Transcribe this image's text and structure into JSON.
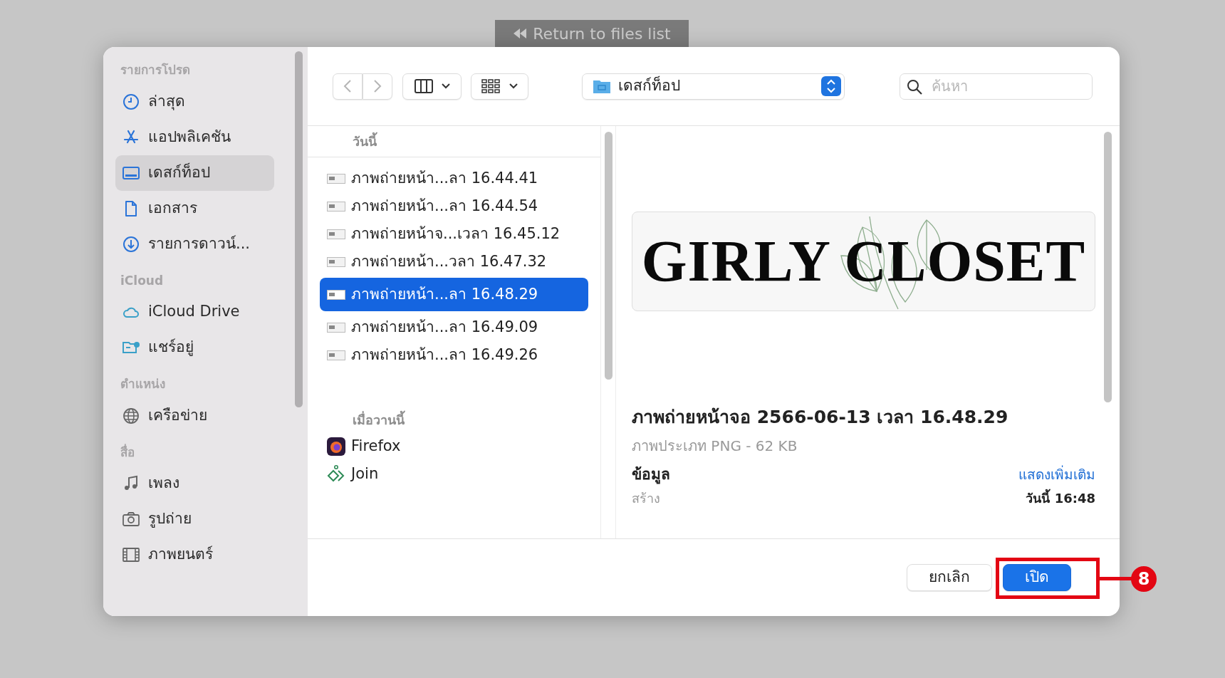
{
  "background_button": {
    "label": "Return to files list"
  },
  "sidebar": {
    "sections": [
      {
        "title": "รายการโปรด",
        "items": [
          {
            "label": "ล่าสุด",
            "selected": false
          },
          {
            "label": "แอปพลิเคชัน",
            "selected": false
          },
          {
            "label": "เดสก์ท็อป",
            "selected": true
          },
          {
            "label": "เอกสาร",
            "selected": false
          },
          {
            "label": "รายการดาวน์...",
            "selected": false
          }
        ]
      },
      {
        "title": "iCloud",
        "items": [
          {
            "label": "iCloud Drive",
            "selected": false
          },
          {
            "label": "แชร์อยู่",
            "selected": false
          }
        ]
      },
      {
        "title": "ตำแหน่ง",
        "items": [
          {
            "label": "เครือข่าย",
            "selected": false
          }
        ]
      },
      {
        "title": "สื่อ",
        "items": [
          {
            "label": "เพลง",
            "selected": false
          },
          {
            "label": "รูปถ่าย",
            "selected": false
          },
          {
            "label": "ภาพยนตร์",
            "selected": false
          }
        ]
      }
    ]
  },
  "toolbar": {
    "location": "เดสก์ท็อป",
    "search": {
      "placeholder": "ค้นหา"
    }
  },
  "file_list": {
    "groups": [
      {
        "title": "วันนี้",
        "items": [
          {
            "name": "ภาพถ่ายหน้า...ลา 16.44.41",
            "kind": "screenshot",
            "selected": false
          },
          {
            "name": "ภาพถ่ายหน้า...ลา 16.44.54",
            "kind": "screenshot",
            "selected": false
          },
          {
            "name": "ภาพถ่ายหน้าจ...เวลา 16.45.12",
            "kind": "screenshot",
            "selected": false
          },
          {
            "name": "ภาพถ่ายหน้า...วลา 16.47.32",
            "kind": "screenshot",
            "selected": false
          },
          {
            "name": "ภาพถ่ายหน้า...ลา 16.48.29",
            "kind": "screenshot",
            "selected": true
          },
          {
            "name": "ภาพถ่ายหน้า...ลา 16.49.09",
            "kind": "screenshot",
            "selected": false
          },
          {
            "name": "ภาพถ่ายหน้า...ลา 16.49.26",
            "kind": "screenshot",
            "selected": false
          }
        ]
      },
      {
        "title": "เมื่อวานนี้",
        "items": [
          {
            "name": "Firefox",
            "kind": "firefox",
            "selected": false
          },
          {
            "name": "Join",
            "kind": "join",
            "selected": false
          }
        ]
      }
    ]
  },
  "preview": {
    "image_text": "GIRLY CLOSET",
    "title": "ภาพถ่ายหน้าจอ 2566-06-13 เวลา 16.48.29",
    "subtitle": "ภาพประเภท PNG - 62 KB",
    "info_heading": "ข้อมูล",
    "show_more": "แสดงเพิ่มเติม",
    "fields": [
      {
        "label": "สร้าง",
        "value": "วันนี้ 16:48"
      }
    ]
  },
  "buttons": [
    {
      "label": "ยกเลิก",
      "kind": "secondary"
    },
    {
      "label": "เปิด",
      "kind": "primary"
    }
  ],
  "annotation": {
    "number": "8"
  }
}
